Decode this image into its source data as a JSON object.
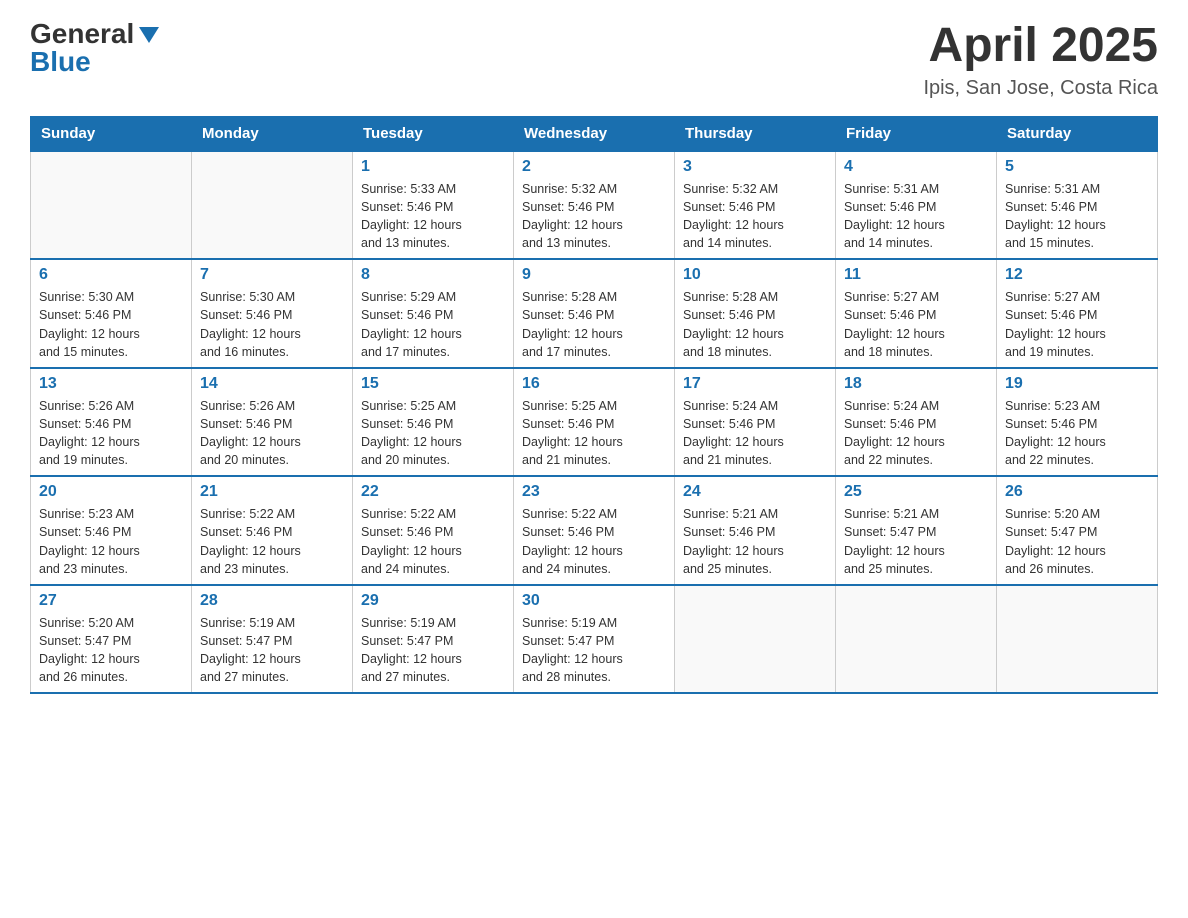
{
  "logo": {
    "general": "General",
    "blue": "Blue"
  },
  "title": {
    "month_year": "April 2025",
    "location": "Ipis, San Jose, Costa Rica"
  },
  "headers": [
    "Sunday",
    "Monday",
    "Tuesday",
    "Wednesday",
    "Thursday",
    "Friday",
    "Saturday"
  ],
  "weeks": [
    [
      {
        "day": "",
        "info": ""
      },
      {
        "day": "",
        "info": ""
      },
      {
        "day": "1",
        "info": "Sunrise: 5:33 AM\nSunset: 5:46 PM\nDaylight: 12 hours\nand 13 minutes."
      },
      {
        "day": "2",
        "info": "Sunrise: 5:32 AM\nSunset: 5:46 PM\nDaylight: 12 hours\nand 13 minutes."
      },
      {
        "day": "3",
        "info": "Sunrise: 5:32 AM\nSunset: 5:46 PM\nDaylight: 12 hours\nand 14 minutes."
      },
      {
        "day": "4",
        "info": "Sunrise: 5:31 AM\nSunset: 5:46 PM\nDaylight: 12 hours\nand 14 minutes."
      },
      {
        "day": "5",
        "info": "Sunrise: 5:31 AM\nSunset: 5:46 PM\nDaylight: 12 hours\nand 15 minutes."
      }
    ],
    [
      {
        "day": "6",
        "info": "Sunrise: 5:30 AM\nSunset: 5:46 PM\nDaylight: 12 hours\nand 15 minutes."
      },
      {
        "day": "7",
        "info": "Sunrise: 5:30 AM\nSunset: 5:46 PM\nDaylight: 12 hours\nand 16 minutes."
      },
      {
        "day": "8",
        "info": "Sunrise: 5:29 AM\nSunset: 5:46 PM\nDaylight: 12 hours\nand 17 minutes."
      },
      {
        "day": "9",
        "info": "Sunrise: 5:28 AM\nSunset: 5:46 PM\nDaylight: 12 hours\nand 17 minutes."
      },
      {
        "day": "10",
        "info": "Sunrise: 5:28 AM\nSunset: 5:46 PM\nDaylight: 12 hours\nand 18 minutes."
      },
      {
        "day": "11",
        "info": "Sunrise: 5:27 AM\nSunset: 5:46 PM\nDaylight: 12 hours\nand 18 minutes."
      },
      {
        "day": "12",
        "info": "Sunrise: 5:27 AM\nSunset: 5:46 PM\nDaylight: 12 hours\nand 19 minutes."
      }
    ],
    [
      {
        "day": "13",
        "info": "Sunrise: 5:26 AM\nSunset: 5:46 PM\nDaylight: 12 hours\nand 19 minutes."
      },
      {
        "day": "14",
        "info": "Sunrise: 5:26 AM\nSunset: 5:46 PM\nDaylight: 12 hours\nand 20 minutes."
      },
      {
        "day": "15",
        "info": "Sunrise: 5:25 AM\nSunset: 5:46 PM\nDaylight: 12 hours\nand 20 minutes."
      },
      {
        "day": "16",
        "info": "Sunrise: 5:25 AM\nSunset: 5:46 PM\nDaylight: 12 hours\nand 21 minutes."
      },
      {
        "day": "17",
        "info": "Sunrise: 5:24 AM\nSunset: 5:46 PM\nDaylight: 12 hours\nand 21 minutes."
      },
      {
        "day": "18",
        "info": "Sunrise: 5:24 AM\nSunset: 5:46 PM\nDaylight: 12 hours\nand 22 minutes."
      },
      {
        "day": "19",
        "info": "Sunrise: 5:23 AM\nSunset: 5:46 PM\nDaylight: 12 hours\nand 22 minutes."
      }
    ],
    [
      {
        "day": "20",
        "info": "Sunrise: 5:23 AM\nSunset: 5:46 PM\nDaylight: 12 hours\nand 23 minutes."
      },
      {
        "day": "21",
        "info": "Sunrise: 5:22 AM\nSunset: 5:46 PM\nDaylight: 12 hours\nand 23 minutes."
      },
      {
        "day": "22",
        "info": "Sunrise: 5:22 AM\nSunset: 5:46 PM\nDaylight: 12 hours\nand 24 minutes."
      },
      {
        "day": "23",
        "info": "Sunrise: 5:22 AM\nSunset: 5:46 PM\nDaylight: 12 hours\nand 24 minutes."
      },
      {
        "day": "24",
        "info": "Sunrise: 5:21 AM\nSunset: 5:46 PM\nDaylight: 12 hours\nand 25 minutes."
      },
      {
        "day": "25",
        "info": "Sunrise: 5:21 AM\nSunset: 5:47 PM\nDaylight: 12 hours\nand 25 minutes."
      },
      {
        "day": "26",
        "info": "Sunrise: 5:20 AM\nSunset: 5:47 PM\nDaylight: 12 hours\nand 26 minutes."
      }
    ],
    [
      {
        "day": "27",
        "info": "Sunrise: 5:20 AM\nSunset: 5:47 PM\nDaylight: 12 hours\nand 26 minutes."
      },
      {
        "day": "28",
        "info": "Sunrise: 5:19 AM\nSunset: 5:47 PM\nDaylight: 12 hours\nand 27 minutes."
      },
      {
        "day": "29",
        "info": "Sunrise: 5:19 AM\nSunset: 5:47 PM\nDaylight: 12 hours\nand 27 minutes."
      },
      {
        "day": "30",
        "info": "Sunrise: 5:19 AM\nSunset: 5:47 PM\nDaylight: 12 hours\nand 28 minutes."
      },
      {
        "day": "",
        "info": ""
      },
      {
        "day": "",
        "info": ""
      },
      {
        "day": "",
        "info": ""
      }
    ]
  ]
}
